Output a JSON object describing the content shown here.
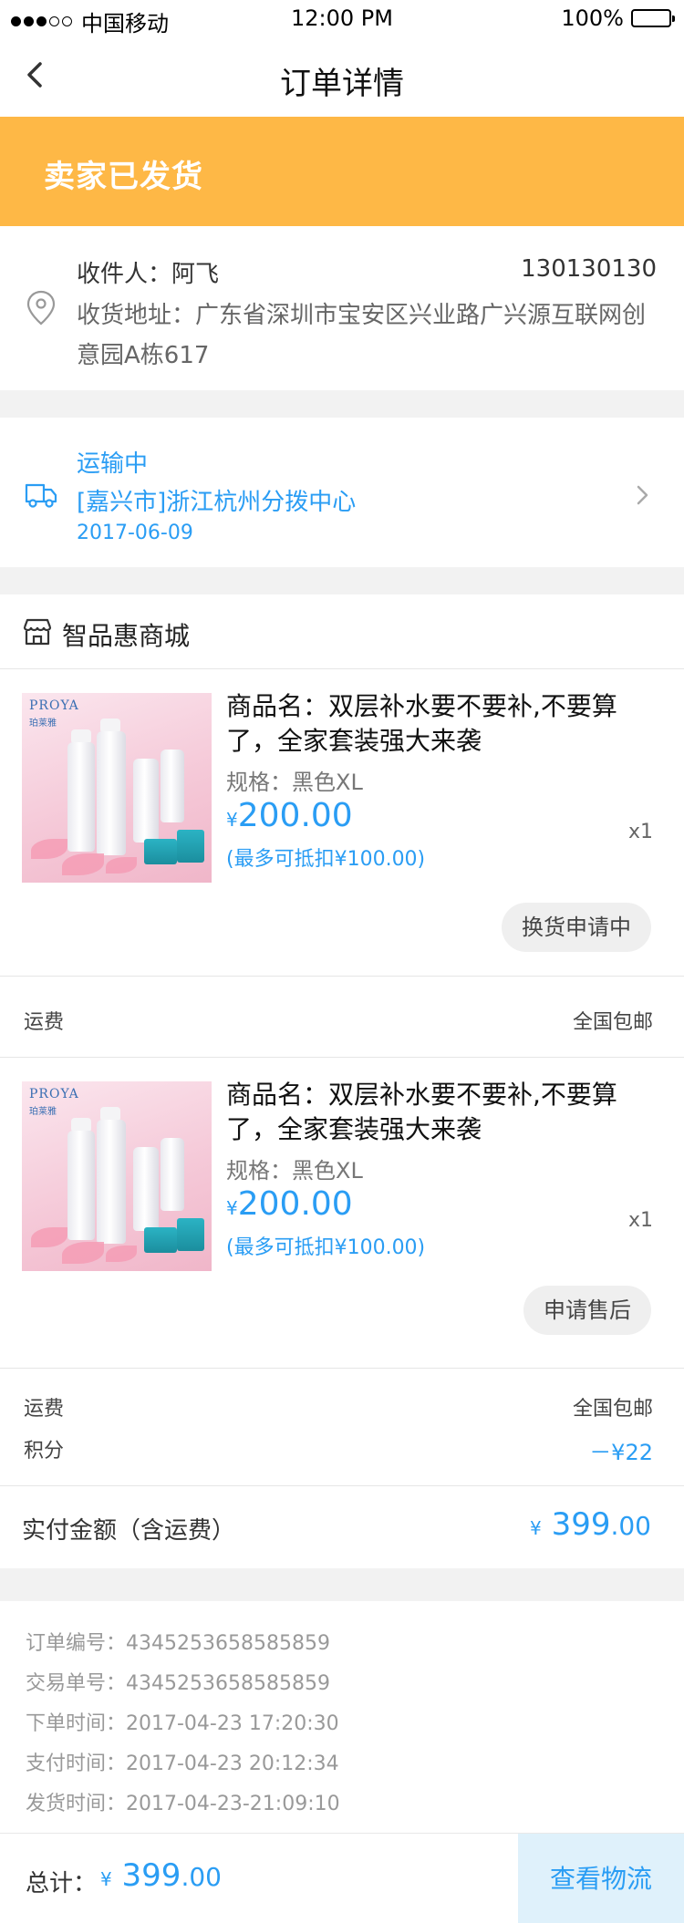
{
  "status_bar": {
    "carrier": "中国移动",
    "time": "12:00 PM",
    "battery": "100%"
  },
  "nav": {
    "title": "订单详情"
  },
  "banner": {
    "text": "卖家已发货",
    "color": "#feb846"
  },
  "address": {
    "recipient": "收件人：阿飞",
    "phone": "130130130",
    "detail": "收货地址：广东省深圳市宝安区兴业路广兴源互联网创意园A栋617"
  },
  "logistics": {
    "status": "运输中",
    "location": "[嘉兴市]浙江杭州分拨中心",
    "date": "2017-06-09"
  },
  "store": {
    "name": "智品惠商城"
  },
  "items": [
    {
      "brand": "PROYA",
      "brand_cn": "珀莱雅",
      "name": "商品名：双层补水要不要补,不要算了，全家套装强大来袭",
      "spec": "规格：黑色XL",
      "currency": "¥",
      "price": "200.00",
      "deduct": "(最多可抵扣¥100.00)",
      "qty": "x1",
      "action": "换货申请中"
    },
    {
      "brand": "PROYA",
      "brand_cn": "珀莱雅",
      "name": "商品名：双层补水要不要补,不要算了，全家套装强大来袭",
      "spec": "规格：黑色XL",
      "currency": "¥",
      "price": "200.00",
      "deduct": "(最多可抵扣¥100.00)",
      "qty": "x1",
      "action": "申请售后"
    }
  ],
  "shipping_1": {
    "label": "运费",
    "value": "全国包邮"
  },
  "shipping_2": {
    "label": "运费",
    "value": "全国包邮"
  },
  "points": {
    "label": "积分",
    "value": "－¥22"
  },
  "paid": {
    "label": "实付金额（含运费）",
    "currency": "¥",
    "integer": "399",
    "decimal": ".00"
  },
  "order_info": [
    "订单编号：4345253658585859",
    "交易单号：4345253658585859",
    "下单时间：2017-04-23 17:20:30",
    "支付时间：2017-04-23 20:12:34",
    "发货时间：2017-04-23-21:09:10"
  ],
  "bottom": {
    "label": "总计：",
    "currency": "¥",
    "integer": "399",
    "decimal": ".00",
    "button": "查看物流"
  },
  "accent_color": "#2a9df4"
}
